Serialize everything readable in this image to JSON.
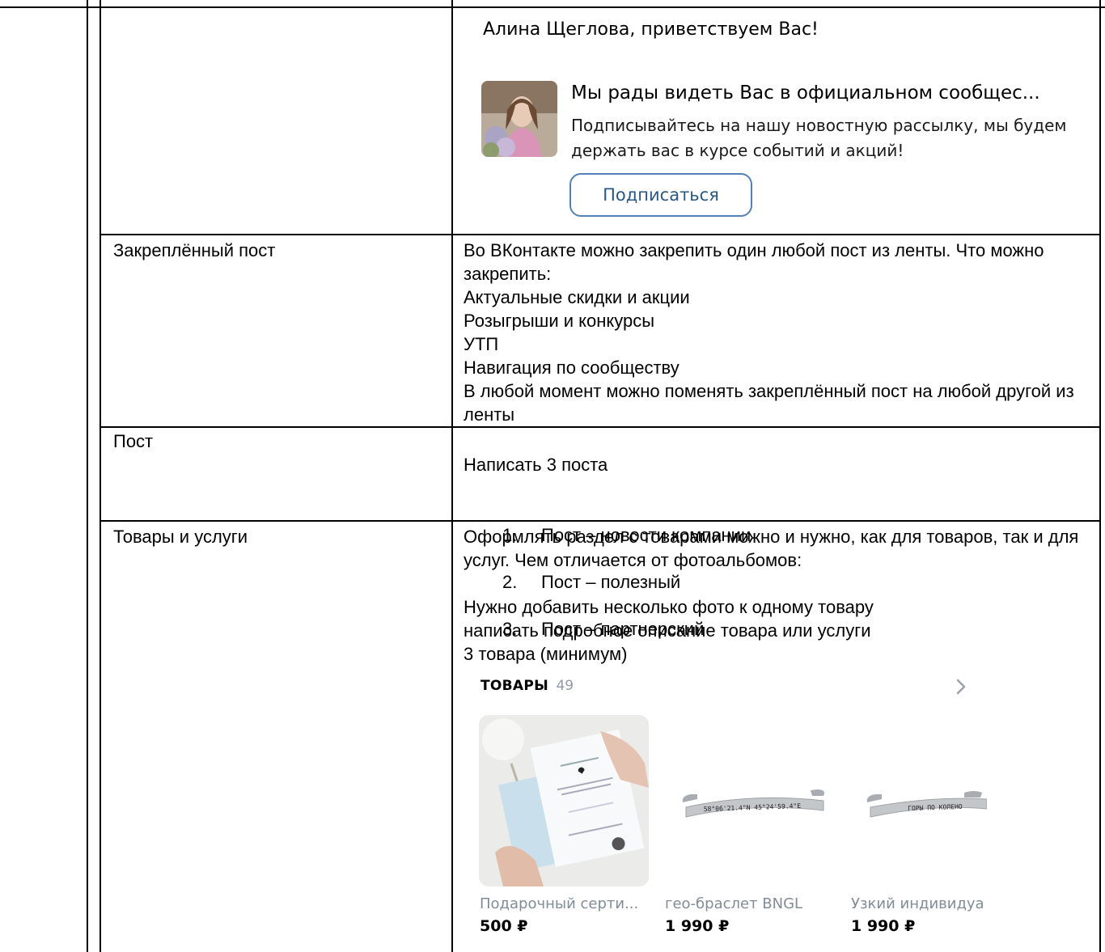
{
  "vk_widget": {
    "greeting": "Алина Щеглова, приветствуем Вас!",
    "title": "Мы рады видеть Вас в официальном сообщес...",
    "text": "Подписывайтесь на нашу новостную рассылку, мы будем держать вас в курсе событий и акций!",
    "subscribe_label": "Подписаться"
  },
  "rows": [
    {
      "label": "Закреплённый пост",
      "description": "Во ВКонтакте можно закрепить один любой пост из ленты. Что можно закрепить:\nАктуальные скидки и акции\nРозыгрыши и конкурсы\nУТП\nНавигация по сообществу\nВ любой момент можно поменять закреплённый пост на любой другой из   ленты"
    },
    {
      "label": "Пост",
      "intro": "Написать 3 поста",
      "items": [
        {
          "num": "1.",
          "text": "Пост – новости компании"
        },
        {
          "num": "2.",
          "text": "Пост – полезный"
        },
        {
          "num": "3.",
          "text": "Пост – партнерский"
        }
      ]
    },
    {
      "label": "Товары и услуги",
      "description": "Оформлять раздел с товарами можно и нужно, как для товаров, так и для услуг. Чем отличается от фотоальбомов:\n\nНужно добавить несколько фото к одному товару\nнаписать подробное описание товара или услуги\n3 товара (минимум)"
    }
  ],
  "goods": {
    "title": "ТОВАРЫ",
    "count": "49",
    "products": [
      {
        "name": "Подарочный серти...",
        "price": "500 ₽",
        "engraving": ""
      },
      {
        "name": "гео-браслет BNGL",
        "price": "1 990 ₽",
        "engraving": "58°06'21.4\"N 45°24'59.4\"E"
      },
      {
        "name": "Узкий индивидуа",
        "price": "1 990 ₽",
        "engraving": "ГОРЫ ПО КОЛЕНО"
      }
    ]
  }
}
